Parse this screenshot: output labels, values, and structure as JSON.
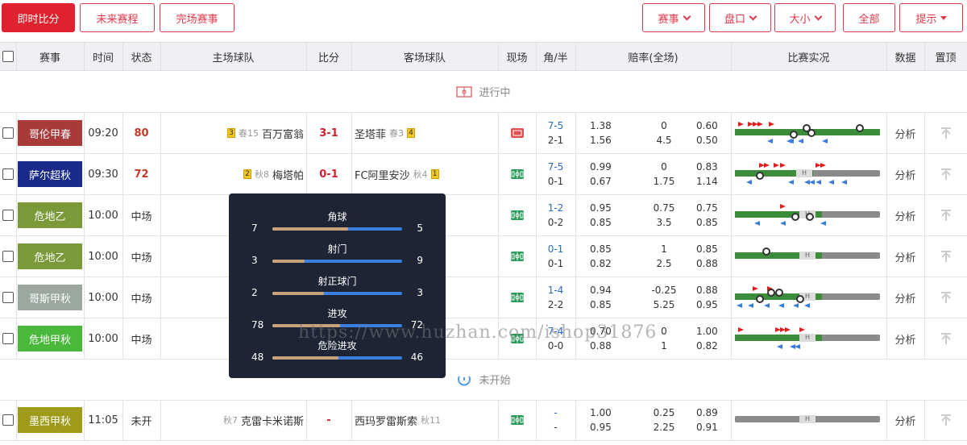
{
  "toolbar": {
    "live": "即时比分",
    "upcoming": "未来赛程",
    "finished": "完场赛事",
    "league": "赛事",
    "handicap": "盘口",
    "size": "大小",
    "all": "全部",
    "tips": "提示"
  },
  "header": {
    "league": "赛事",
    "time": "时间",
    "status": "状态",
    "home": "主场球队",
    "score": "比分",
    "away": "客场球队",
    "live": "现场",
    "corner": "角/半",
    "odds": "赔率(全场)",
    "events": "比赛实况",
    "data": "数据",
    "pin": "置顶"
  },
  "sections": {
    "inplay": "进行中",
    "notstarted": "未开始"
  },
  "rows": [
    {
      "league": "哥伦甲春",
      "color": "#a83a3a",
      "time": "09:20",
      "status": "80",
      "home": "百万富翁",
      "home_rank": "春15",
      "home_card": "3",
      "score": "3-1",
      "away": "圣塔菲",
      "away_rank": "春3",
      "away_card": "4",
      "corner": "7-5",
      "half": "2-1",
      "o1": [
        "1.38",
        "0",
        "0.60"
      ],
      "o2": [
        "1.56",
        "4.5",
        "0.50"
      ],
      "analysis": "分析",
      "live_icon": "video"
    },
    {
      "league": "萨尔超秋",
      "color": "#1a2a8a",
      "time": "09:30",
      "status": "72",
      "home": "梅塔帕",
      "home_rank": "秋8",
      "home_card": "2",
      "score": "0-1",
      "away": "FC阿里安沙",
      "away_rank": "秋4",
      "away_card": "1",
      "corner": "7-5",
      "half": "0-1",
      "o1": [
        "0.99",
        "0",
        "0.83"
      ],
      "o2": [
        "0.67",
        "1.75",
        "1.14"
      ],
      "analysis": "分析",
      "live_icon": "field"
    },
    {
      "league": "危地乙",
      "color": "#7a9a3a",
      "time": "10:00",
      "status": "中场",
      "corner": "1-2",
      "half": "0-2",
      "o1": [
        "0.95",
        "0.75",
        "0.75"
      ],
      "o2": [
        "0.85",
        "3.5",
        "0.85"
      ],
      "analysis": "分析",
      "live_icon": "field"
    },
    {
      "league": "危地乙",
      "color": "#7a9a3a",
      "time": "10:00",
      "status": "中场",
      "corner": "0-1",
      "half": "0-1",
      "o1": [
        "0.85",
        "1",
        "0.85"
      ],
      "o2": [
        "0.82",
        "2.5",
        "0.88"
      ],
      "analysis": "分析",
      "live_icon": "field"
    },
    {
      "league": "哥斯甲秋",
      "color": "#9aa8a0",
      "time": "10:00",
      "status": "中场",
      "corner": "1-4",
      "half": "2-2",
      "o1": [
        "0.94",
        "-0.25",
        "0.88"
      ],
      "o2": [
        "0.85",
        "5.25",
        "0.95"
      ],
      "analysis": "分析",
      "live_icon": "field"
    },
    {
      "league": "危地甲秋",
      "color": "#4ab83a",
      "time": "10:00",
      "status": "中场",
      "corner": "7-4",
      "half": "0-0",
      "o1": [
        "0.70",
        "0",
        "1.00"
      ],
      "o2": [
        "0.88",
        "1",
        "0.82"
      ],
      "analysis": "分析",
      "live_icon": "field"
    },
    {
      "league": "墨西甲秋",
      "color": "#a09a1a",
      "time": "11:05",
      "status": "未开",
      "home": "克雷卡米诺斯",
      "home_rank": "秋7",
      "score": "-",
      "away": "西玛罗雷斯索",
      "away_rank": "秋11",
      "corner": "-",
      "half": "-",
      "o1": [
        "1.00",
        "0.25",
        "0.89"
      ],
      "o2": [
        "0.95",
        "2.25",
        "0.91"
      ],
      "analysis": "分析",
      "live_icon": "field"
    }
  ],
  "popup": {
    "stats": [
      {
        "label": "角球",
        "home": 7,
        "away": 5
      },
      {
        "label": "射门",
        "home": 3,
        "away": 9
      },
      {
        "label": "射正球门",
        "home": 2,
        "away": 3
      },
      {
        "label": "进攻",
        "home": 78,
        "away": 72
      },
      {
        "label": "危险进攻",
        "home": 48,
        "away": 46
      }
    ]
  },
  "watermark": "https://www.huzhan.com/ishop31876",
  "colors": {
    "accent": "#e0212e",
    "blue": "#2b6ac2",
    "popup_bg": "#1d2433"
  }
}
